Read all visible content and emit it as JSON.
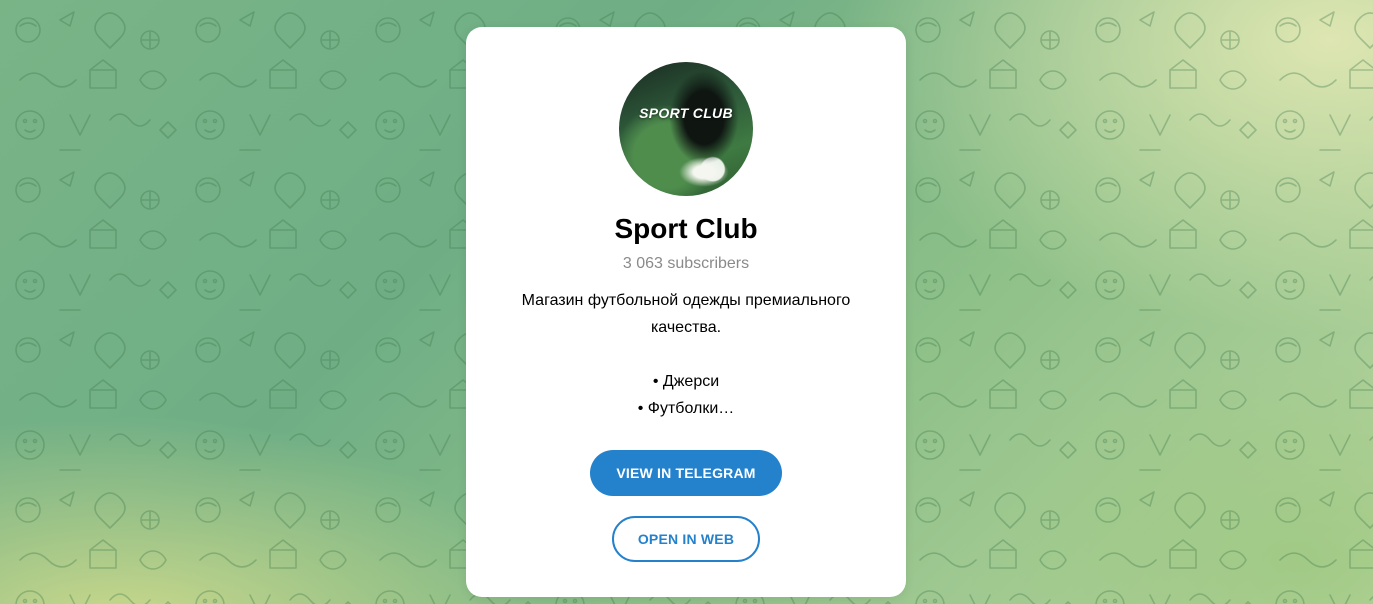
{
  "channel": {
    "avatar_text": "SPORT CLUB",
    "title": "Sport Club",
    "subscribers": "3 063 subscribers",
    "description_lines": [
      "Магазин футбольной одежды премиального",
      "качества.",
      "",
      "• Джерси",
      "• Футболки…"
    ]
  },
  "buttons": {
    "view_in_telegram": "VIEW IN TELEGRAM",
    "open_in_web": "OPEN IN WEB"
  },
  "colors": {
    "accent": "#2481cc",
    "background_green": "#79b487",
    "card": "#ffffff"
  },
  "icons": {
    "background": "doodle-pattern"
  }
}
